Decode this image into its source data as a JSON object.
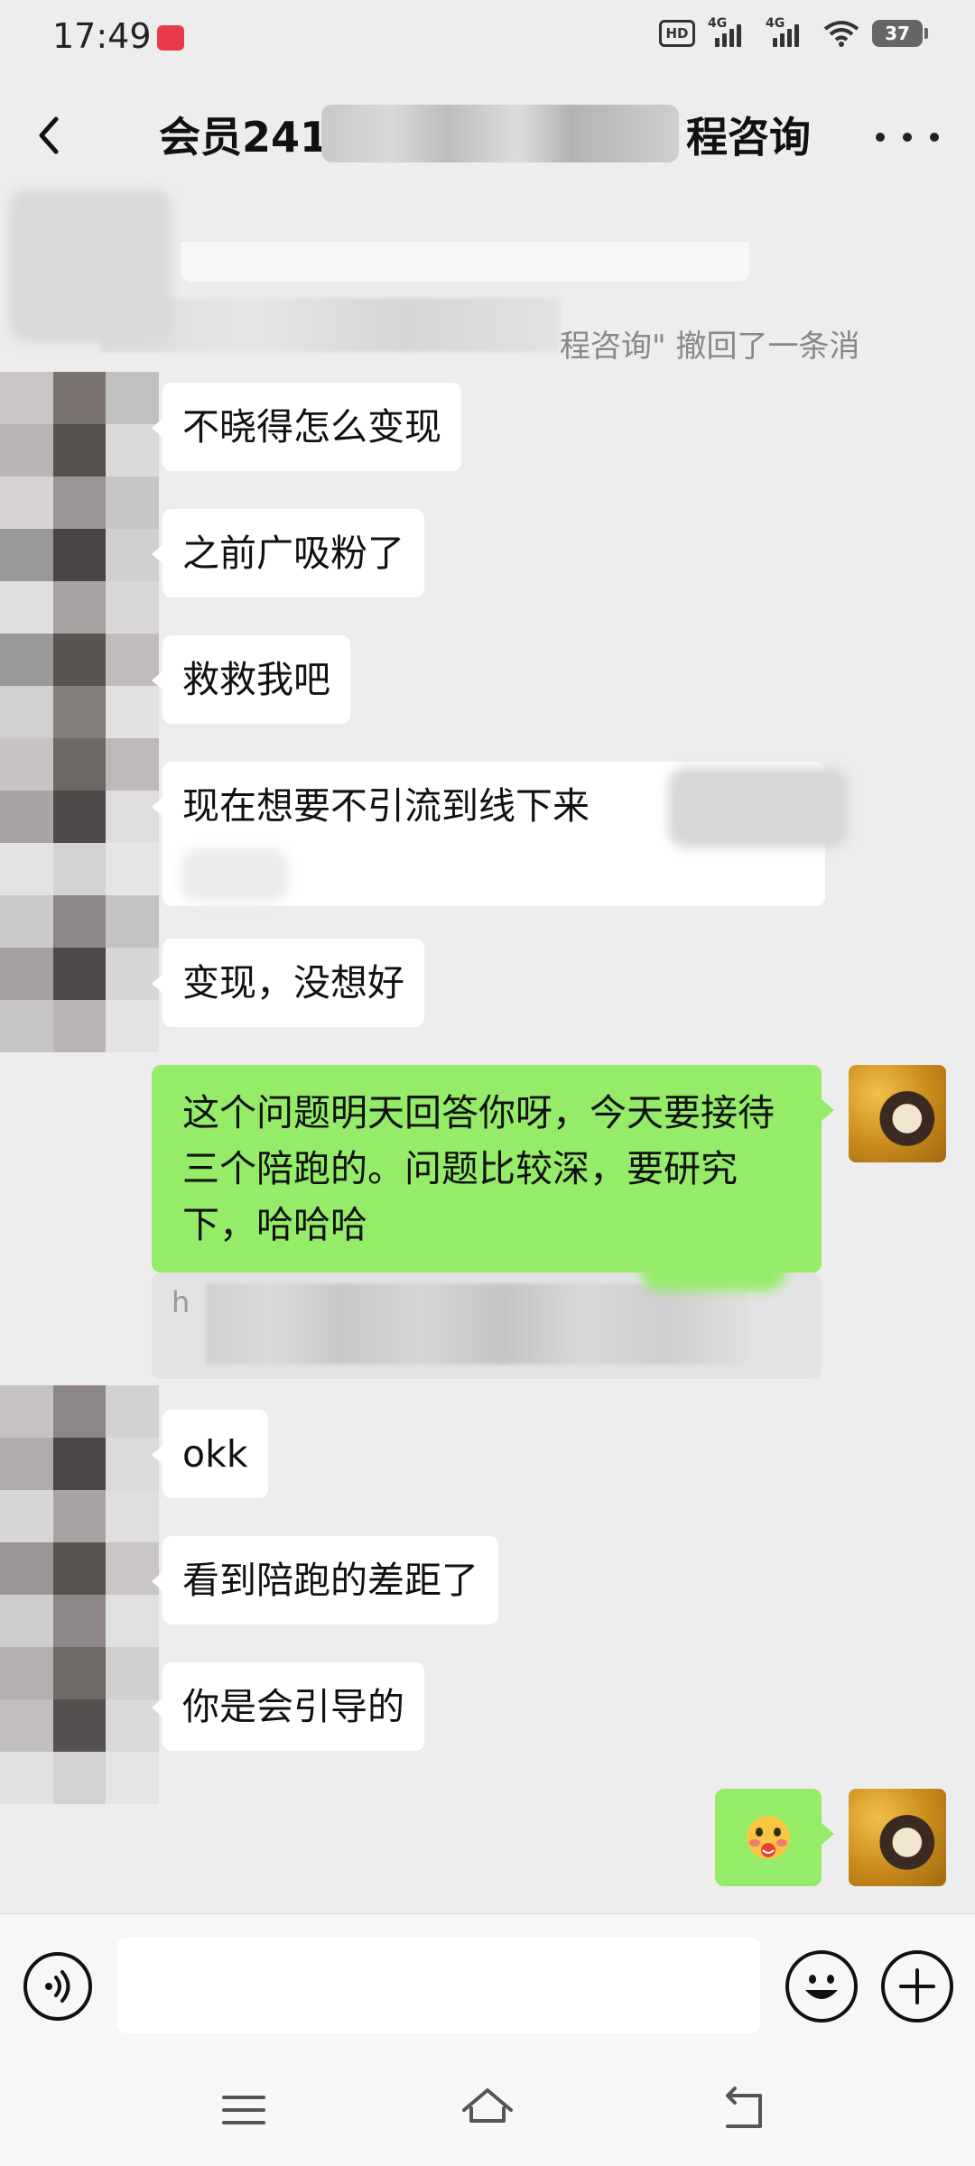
{
  "status_bar": {
    "time": "17:49",
    "hd_label": "HD",
    "signal_1_label": "4G",
    "signal_2_label": "4G",
    "battery": "37",
    "icons": [
      "notification-app-icon",
      "hd-icon",
      "signal-icon",
      "signal-icon",
      "wifi-icon",
      "battery-icon"
    ]
  },
  "header": {
    "title_start": "会员241",
    "title_end": "程咨询",
    "back_icon": "back-arrow-icon",
    "more_icon": "more-dots-icon"
  },
  "recall": {
    "text": "程咨询\"  撤回了一条消"
  },
  "messages": [
    {
      "side": "left",
      "text": "不晓得怎么变现"
    },
    {
      "side": "left",
      "text": "之前广吸粉了"
    },
    {
      "side": "left",
      "text": "救救我吧"
    },
    {
      "side": "left",
      "text": "现在想要不引流到线下来"
    },
    {
      "side": "left",
      "text": "变现，没想好"
    },
    {
      "side": "right",
      "text": "这个问题明天回答你呀，今天要接待三个陪跑的。问题比较深，要研究下，哈哈哈"
    },
    {
      "side": "left",
      "text": "okk"
    },
    {
      "side": "left",
      "text": "看到陪跑的差距了"
    },
    {
      "side": "left",
      "text": "你是会引导的"
    },
    {
      "side": "right",
      "text": "",
      "emoji": "shy-face-emoji"
    }
  ],
  "quote": {
    "lead": "h"
  },
  "input_bar": {
    "placeholder": "",
    "icons": [
      "voice-icon",
      "emoji-icon",
      "plus-icon"
    ]
  },
  "nav_bar": {
    "icons": [
      "menu-icon",
      "home-icon",
      "back-icon"
    ]
  },
  "colors": {
    "background": "#ededed",
    "my_bubble": "#95ec69",
    "their_bubble": "#ffffff",
    "notification": "#e83a4a"
  }
}
